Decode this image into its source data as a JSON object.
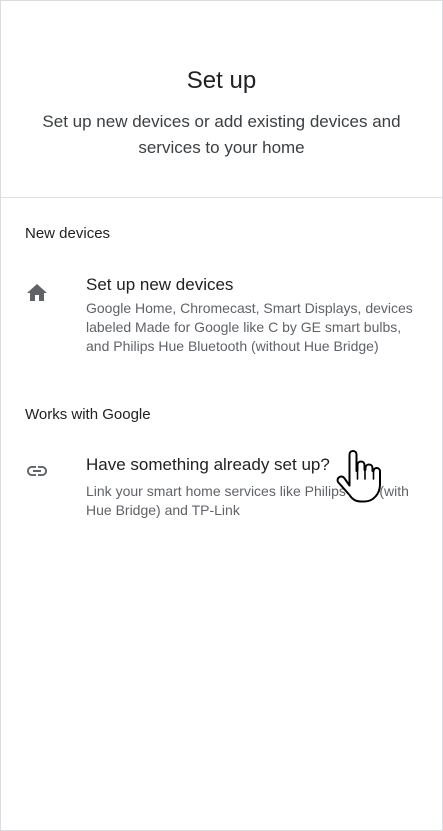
{
  "header": {
    "title": "Set up",
    "subtitle": "Set up new devices or add existing devices and services to your home"
  },
  "sections": {
    "new_devices": {
      "label": "New devices",
      "item": {
        "icon": "home-icon",
        "title": "Set up new devices",
        "description": "Google Home, Chromecast, Smart Displays, devices labeled Made for Google like C by GE smart bulbs, and Philips Hue Bluetooth (without Hue Bridge)"
      }
    },
    "works_with_google": {
      "label": "Works with Google",
      "item": {
        "icon": "link-icon",
        "title": "Have something already set up?",
        "description": "Link your smart home services like Philips Hue (with Hue Bridge) and TP-Link"
      }
    }
  },
  "colors": {
    "text_primary": "#202124",
    "text_secondary": "#5f6368",
    "divider": "#e0e0e0",
    "icon": "#5f6368"
  }
}
